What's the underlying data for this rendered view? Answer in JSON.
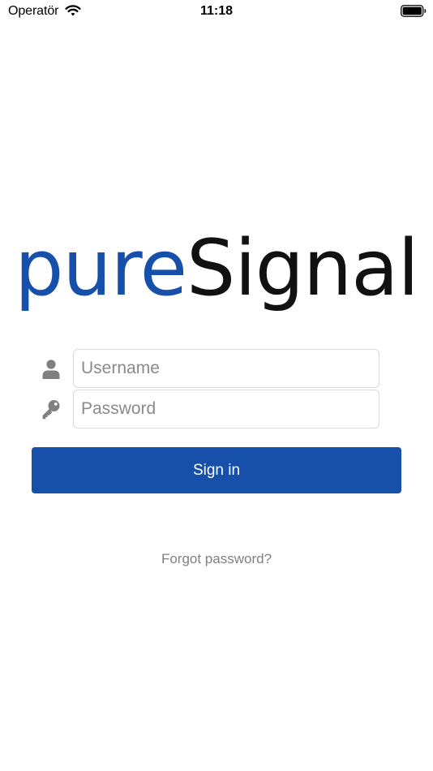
{
  "status_bar": {
    "carrier": "Operatör",
    "time": "11:18",
    "wifi_icon": "wifi-icon",
    "battery_icon": "battery-icon"
  },
  "logo": {
    "part1": "pure",
    "part2": "Signal",
    "part1_color": "#1650aa",
    "part2_color": "#111111"
  },
  "form": {
    "username": {
      "placeholder": "Username",
      "value": "",
      "icon": "person-icon"
    },
    "password": {
      "placeholder": "Password",
      "value": "",
      "icon": "key-icon"
    },
    "signin_label": "Sign in",
    "forgot_label": "Forgot password?"
  },
  "colors": {
    "accent": "#1650aa",
    "link": "#808080",
    "icon": "#808080"
  }
}
